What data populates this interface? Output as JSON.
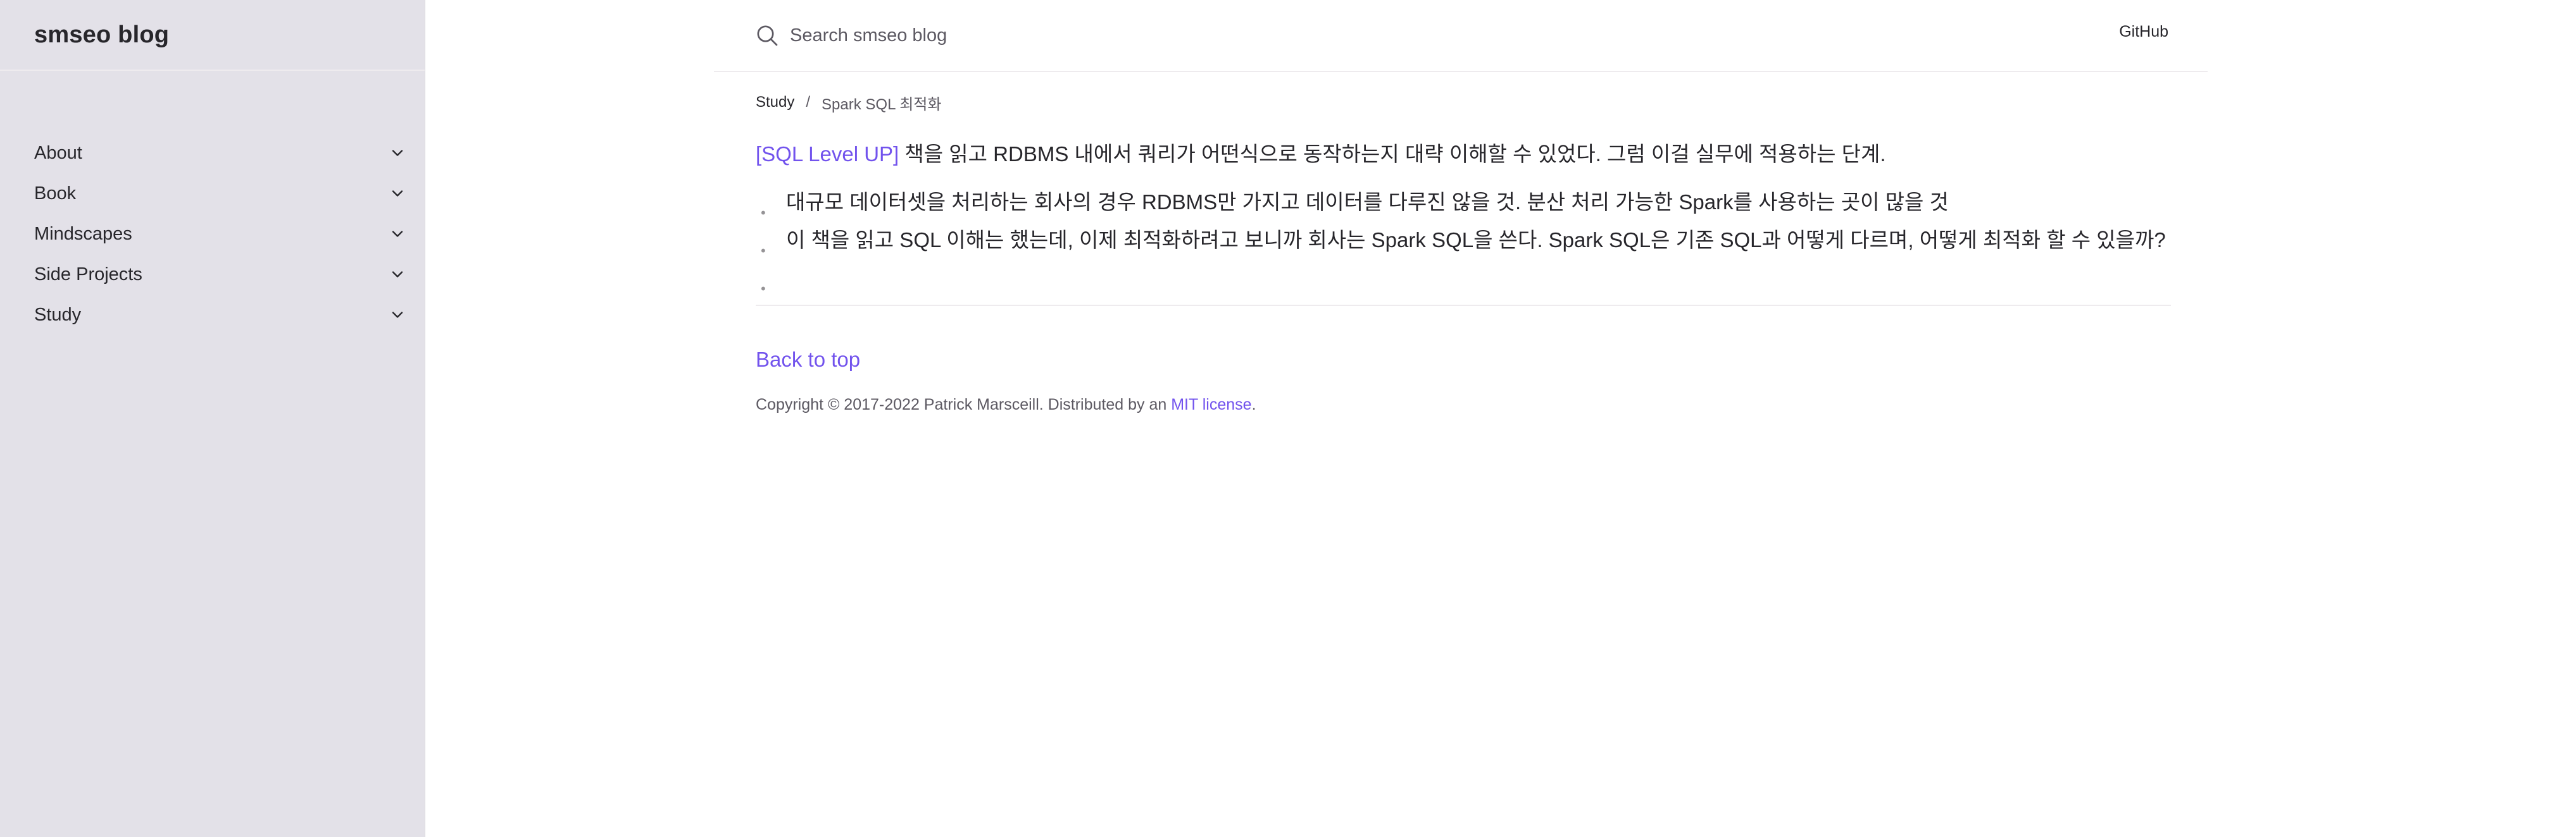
{
  "sidebar": {
    "site_title": "smseo blog",
    "items": [
      {
        "label": "About"
      },
      {
        "label": "Book"
      },
      {
        "label": "Mindscapes"
      },
      {
        "label": "Side Projects"
      },
      {
        "label": "Study"
      }
    ]
  },
  "header": {
    "search_placeholder": "Search smseo blog",
    "aux_link": "GitHub"
  },
  "breadcrumb": {
    "parent": "Study",
    "separator": "/",
    "current": "Spark SQL 최적화"
  },
  "content": {
    "intro_link": "[SQL Level UP]",
    "intro_text": " 책을 읽고 RDBMS 내에서 쿼리가 어떤식으로 동작하는지 대략 이해할 수 있었다. 그럼 이걸 실무에 적용하는 단계.",
    "bullets": [
      "대규모 데이터셋을 처리하는 회사의 경우 RDBMS만 가지고 데이터를 다루진 않을 것. 분산 처리 가능한 Spark를 사용하는 곳이 많을 것",
      "이 책을 읽고 SQL 이해는 했는데, 이제 최적화하려고 보니까 회사는 Spark SQL을 쓴다. Spark SQL은 기존 SQL과 어떻게 다르며, 어떻게 최적화 할 수 있을까?",
      ""
    ],
    "bullet_marker": "•"
  },
  "back_to_top": "Back to top",
  "footer": {
    "text": "Copyright © 2017-2022 Patrick Marsceill. Distributed by an ",
    "license_link": "MIT license",
    "end": "."
  },
  "colors": {
    "accent": "#7253ed",
    "sidebar_bg": "#e3e1e8",
    "text_dark": "#27262b"
  }
}
